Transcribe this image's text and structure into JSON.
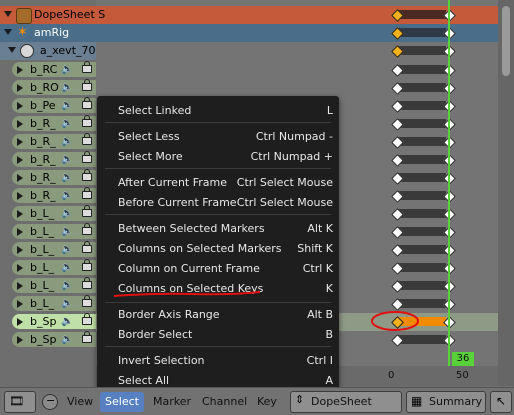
{
  "channels": {
    "action": "DopeSheet S",
    "object": "amRig",
    "armature": "a_xevt_70",
    "bones": [
      "b_RC",
      "b_RO",
      "b_Pe",
      "b_R_",
      "b_R_",
      "b_R_",
      "b_R_",
      "b_R_",
      "b_L_",
      "b_L_",
      "b_L_",
      "b_L_",
      "b_L_",
      "b_L_",
      "b_Sp",
      "b_Sp"
    ]
  },
  "menu": {
    "items": [
      {
        "label": "Select Linked",
        "shortcut": "L"
      },
      {
        "label": "Select Less",
        "shortcut": "Ctrl Numpad -"
      },
      {
        "label": "Select More",
        "shortcut": "Ctrl Numpad +"
      },
      {
        "label": "After Current Frame",
        "shortcut": "Ctrl Select Mouse"
      },
      {
        "label": "Before Current Frame",
        "shortcut": "Ctrl Select Mouse"
      },
      {
        "label": "Between Selected Markers",
        "shortcut": "Alt K"
      },
      {
        "label": "Columns on Selected Markers",
        "shortcut": "Shift K"
      },
      {
        "label": "Column on Current Frame",
        "shortcut": "Ctrl K"
      },
      {
        "label": "Columns on Selected Keys",
        "shortcut": "K"
      },
      {
        "label": "Border Axis Range",
        "shortcut": "Alt B"
      },
      {
        "label": "Border Select",
        "shortcut": "B"
      },
      {
        "label": "Invert Selection",
        "shortcut": "Ctrl I"
      },
      {
        "label": "Select All",
        "shortcut": "A"
      }
    ]
  },
  "timeline": {
    "current_frame": "36",
    "ruler": [
      "0",
      "50"
    ]
  },
  "header": {
    "menus": [
      "View",
      "Select",
      "Marker",
      "Channel",
      "Key"
    ],
    "active_menu": "Select",
    "mode": "DopeSheet",
    "summary": "Summary"
  },
  "colors": {
    "summary_row": "#c45a3a",
    "object_row": "#4a6e8a",
    "menu_bg": "#1e1e1e",
    "accent_green": "#58d13b",
    "selected_channel": "#bfe0a6",
    "annotation_red": "#e01010"
  }
}
